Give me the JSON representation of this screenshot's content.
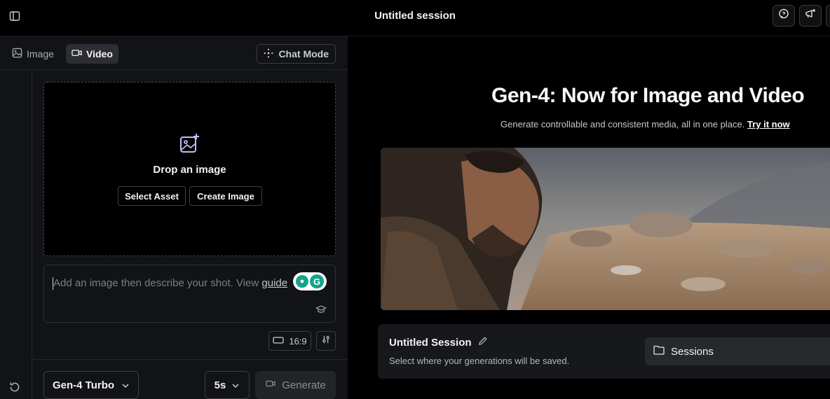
{
  "header": {
    "title": "Untitled session"
  },
  "left_panel": {
    "tabs": [
      {
        "label": "Image",
        "icon": "image-icon",
        "active": false
      },
      {
        "label": "Video",
        "icon": "video-icon",
        "active": true
      }
    ],
    "chat_mode_label": "Chat Mode",
    "dropzone": {
      "label": "Drop an image",
      "select_asset_label": "Select Asset",
      "create_image_label": "Create Image"
    },
    "prompt": {
      "placeholder": "Add an image then describe your shot. View ",
      "guide_link": "guide"
    },
    "aspect_ratio": "16:9",
    "model": "Gen-4 Turbo",
    "duration": "5s",
    "generate_label": "Generate"
  },
  "right_panel": {
    "hero_title": "Gen-4: Now for Image and Video",
    "hero_subtitle": "Generate controllable and consistent media, all in one place.",
    "try_link": "Try it now",
    "session": {
      "title": "Untitled Session",
      "subtitle": "Select where your generations will be saved.",
      "sessions_label": "Sessions"
    }
  },
  "colors": {
    "accent_grammarly": "#15a38a",
    "panel_bg": "#121316",
    "card_bg": "#17181b"
  }
}
